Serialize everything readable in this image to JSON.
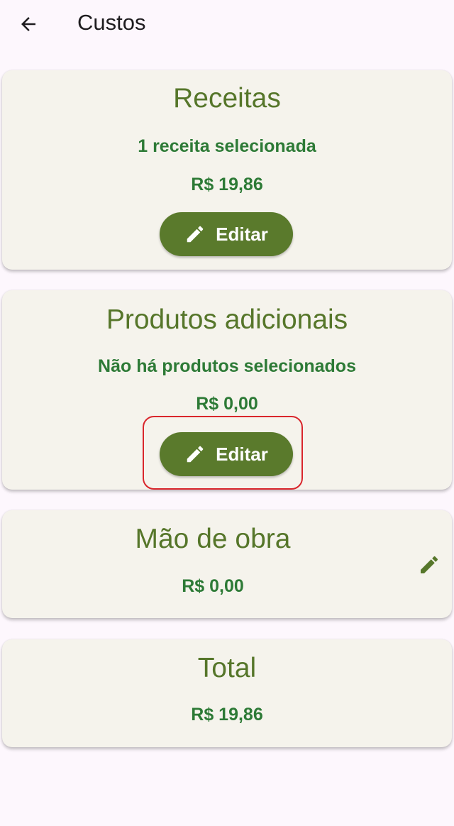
{
  "app_bar": {
    "title": "Custos",
    "back_icon": "arrow-back-icon"
  },
  "cards": {
    "recipes": {
      "title": "Receitas",
      "subtitle": "1 receita selecionada",
      "amount": "R$ 19,86",
      "button_label": "Editar",
      "button_icon": "pencil-icon"
    },
    "products": {
      "title": "Produtos adicionais",
      "subtitle": "Não há produtos selecionados",
      "amount": "R$ 0,00",
      "button_label": "Editar",
      "button_icon": "pencil-icon"
    },
    "labor": {
      "title": "Mão de obra",
      "amount": "R$ 0,00",
      "edit_icon": "pencil-icon"
    },
    "total": {
      "title": "Total",
      "amount": "R$ 19,86"
    }
  },
  "colors": {
    "background": "#fdf7fd",
    "card": "#f5f3ec",
    "accent_green": "#5a7a2c",
    "title_green": "#56762a",
    "value_green": "#2d7a36",
    "highlight_red": "#d9262c"
  }
}
